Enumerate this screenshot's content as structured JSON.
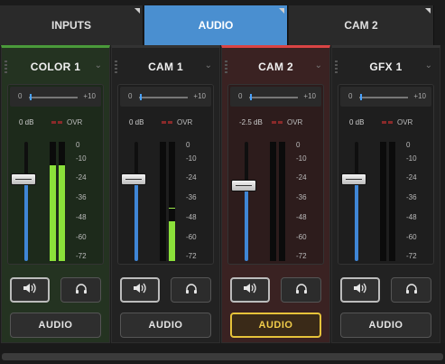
{
  "tabs": [
    {
      "label": "INPUTS",
      "active": false
    },
    {
      "label": "AUDIO",
      "active": true
    },
    {
      "label": "CAM 2",
      "active": false
    }
  ],
  "trim": {
    "min": "0",
    "max": "+10"
  },
  "ovr_label": "OVR",
  "scale": [
    "0",
    "-10",
    "-24",
    "-36",
    "-48",
    "-60",
    "-72"
  ],
  "strips": [
    {
      "title": "COLOR 1",
      "gain": "0 dB",
      "trim_pos": 0.0,
      "fader_pos": 0.71,
      "meter_left": 0.8,
      "meter_right": 0.8,
      "audio_label": "AUDIO",
      "audio_active": false,
      "state": "program"
    },
    {
      "title": "CAM 1",
      "gain": "0 dB",
      "trim_pos": 0.0,
      "fader_pos": 0.71,
      "meter_left": 0,
      "meter_right": 0.33,
      "meter_right_peak": 0.45,
      "audio_label": "AUDIO",
      "audio_active": false,
      "state": "normal"
    },
    {
      "title": "CAM 2",
      "gain": "-2.5 dB",
      "trim_pos": 0.0,
      "fader_pos": 0.65,
      "meter_left": 0,
      "meter_right": 0,
      "audio_label": "AUDIO",
      "audio_active": true,
      "state": "preview"
    },
    {
      "title": "GFX 1",
      "gain": "0 dB",
      "trim_pos": 0.0,
      "fader_pos": 0.71,
      "meter_left": 0,
      "meter_right": 0,
      "audio_label": "AUDIO",
      "audio_active": false,
      "state": "normal"
    }
  ],
  "colors": {
    "accent": "#4a8fd0",
    "program": "#4a9a3a",
    "preview": "#d94444",
    "meter": "#8be03a",
    "audio_active": "#e6c23a"
  },
  "icons": {
    "speaker": "speaker-icon",
    "headphones": "headphones-icon"
  }
}
